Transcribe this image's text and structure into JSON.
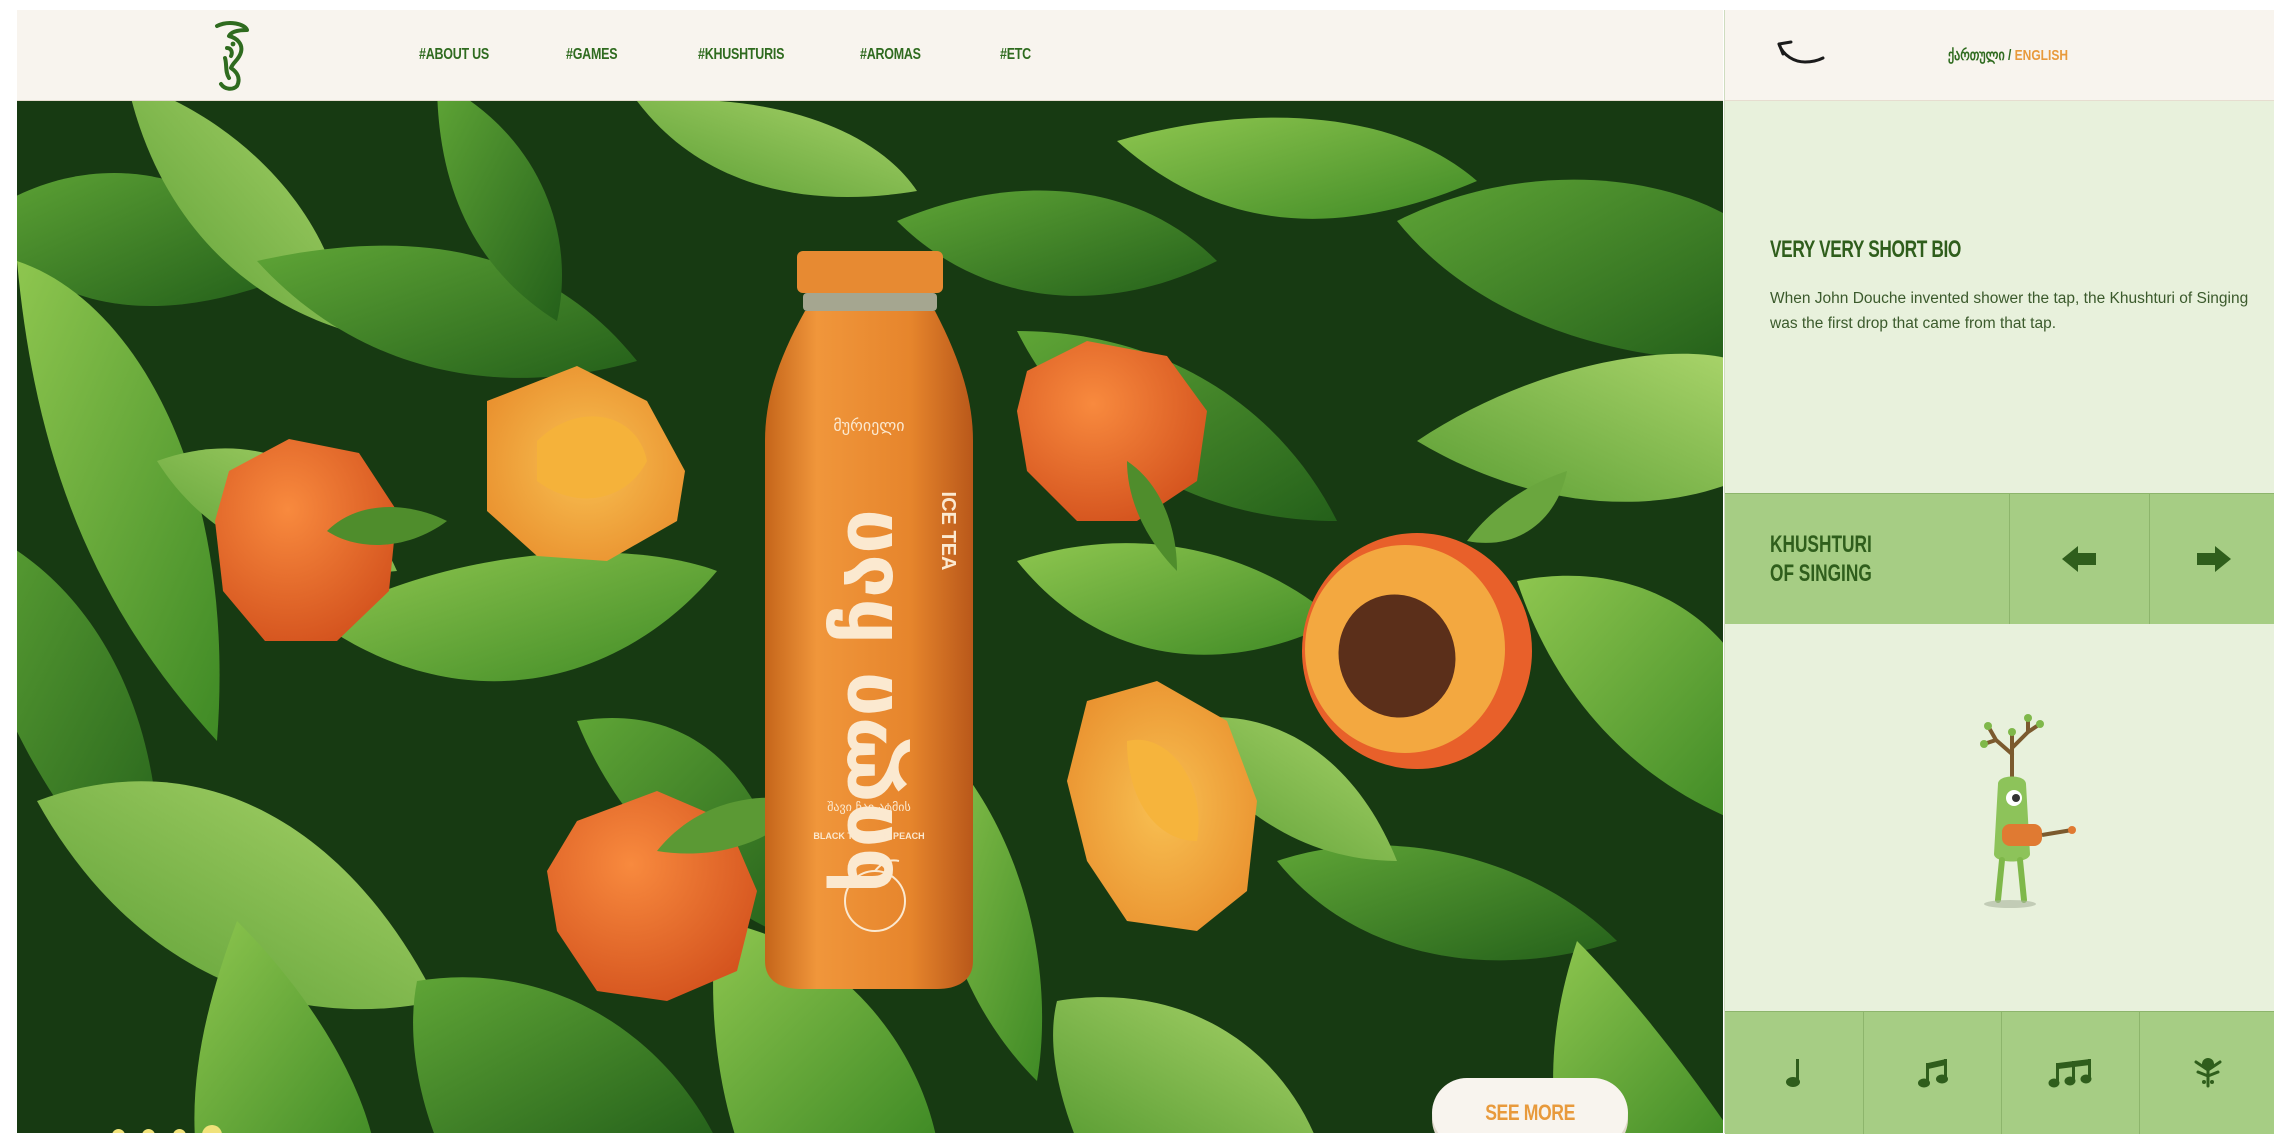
{
  "nav": {
    "items": [
      {
        "label": "#ABOUT US"
      },
      {
        "label": "#GAMES"
      },
      {
        "label": "#KHUSHTURIS"
      },
      {
        "label": "#AROMAS"
      },
      {
        "label": "#ETC"
      }
    ]
  },
  "language": {
    "georgian": "ქართული",
    "separator": "/",
    "english": "ENGLISH"
  },
  "hero": {
    "slides": {
      "count": 4,
      "active": 4
    },
    "see_more_label": "SEE MORE",
    "bottle": {
      "brand": "მურიელი",
      "name": "ხილი ჩაი",
      "type": "ICE TEA",
      "subtitle": "შავი ჩაი ატმის",
      "caption": "BLACK TEA WITH PEACH"
    }
  },
  "bio": {
    "title": "VERY VERY SHORT BIO",
    "text": "When John Douche invented shower the tap, the Khushturi of Singing was the first drop that came from that tap."
  },
  "player": {
    "title_line1": "KHUSHTURI",
    "title_line2": "OF SINGING"
  },
  "notes": [
    {
      "icon": "quarter-note-icon"
    },
    {
      "icon": "double-note-icon"
    },
    {
      "icon": "triple-note-icon"
    },
    {
      "icon": "tree-figure-icon"
    }
  ],
  "colors": {
    "accent_orange": "#e89a3c",
    "brand_green": "#2f6b1f",
    "panel_light": "#e8f1dc",
    "panel_mid": "#a6cd84",
    "cream": "#f8f4ee"
  }
}
